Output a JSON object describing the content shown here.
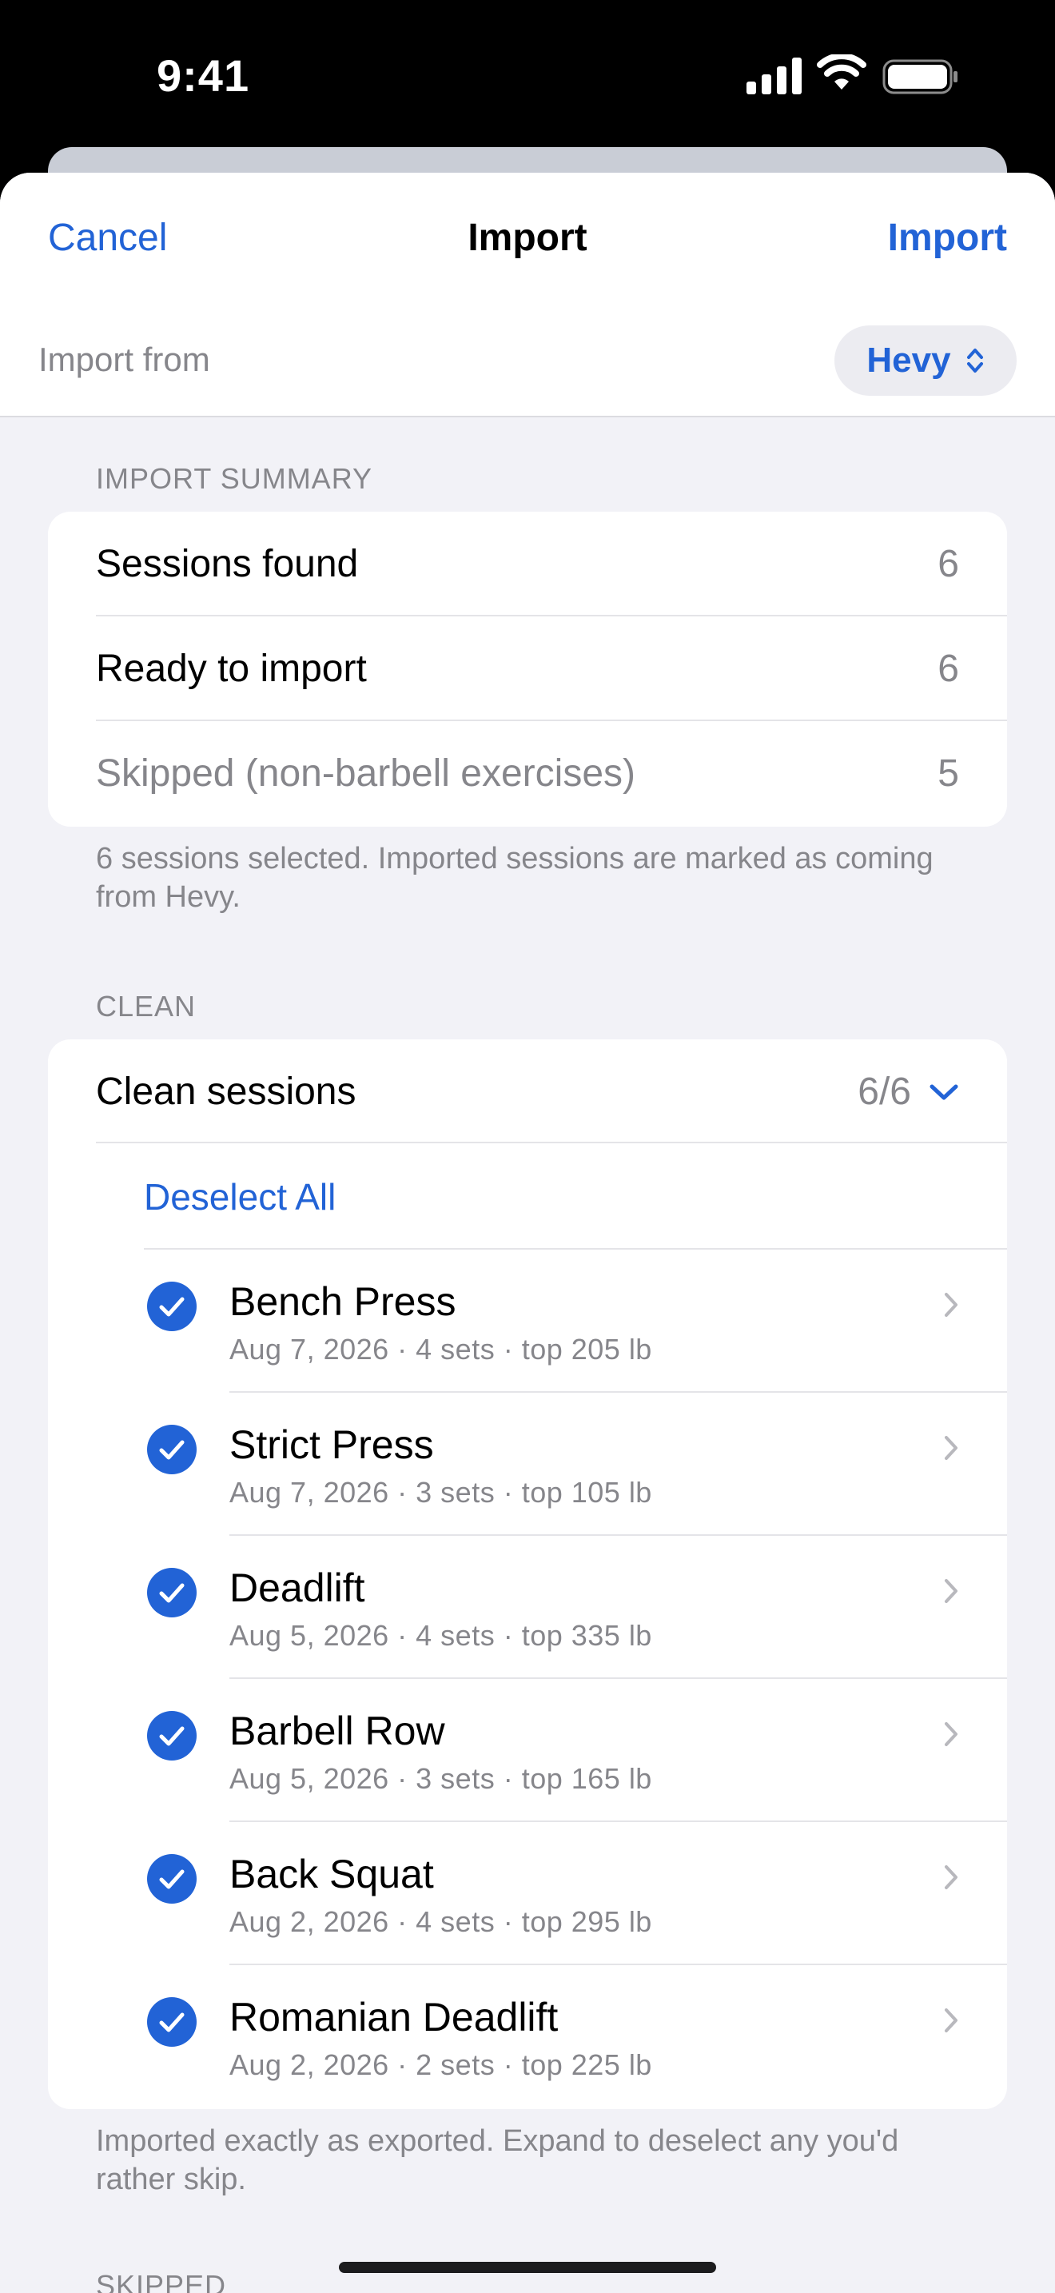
{
  "status_bar": {
    "time": "9:41"
  },
  "nav": {
    "cancel": "Cancel",
    "title": "Import",
    "import": "Import"
  },
  "source": {
    "label": "Import from",
    "value": "Hevy"
  },
  "summary": {
    "header": "IMPORT SUMMARY",
    "rows": [
      {
        "label": "Sessions found",
        "value": "6"
      },
      {
        "label": "Ready to import",
        "value": "6"
      },
      {
        "label": "Skipped (non-barbell exercises)",
        "value": "5"
      }
    ],
    "footnote": "6 sessions selected. Imported sessions are marked as coming from Hevy."
  },
  "clean": {
    "header": "CLEAN",
    "title": "Clean sessions",
    "count": "6/6",
    "deselect_all": "Deselect All",
    "sessions": [
      {
        "name": "Bench Press",
        "meta": "Aug 7, 2026 · 4 sets · top 205 lb",
        "selected": true
      },
      {
        "name": "Strict Press",
        "meta": "Aug 7, 2026 · 3 sets · top 105 lb",
        "selected": true
      },
      {
        "name": "Deadlift",
        "meta": "Aug 5, 2026 · 4 sets · top 335 lb",
        "selected": true
      },
      {
        "name": "Barbell Row",
        "meta": "Aug 5, 2026 · 3 sets · top 165 lb",
        "selected": true
      },
      {
        "name": "Back Squat",
        "meta": "Aug 2, 2026 · 4 sets · top 295 lb",
        "selected": true
      },
      {
        "name": "Romanian Deadlift",
        "meta": "Aug 2, 2026 · 2 sets · top 225 lb",
        "selected": true
      }
    ],
    "footnote": "Imported exactly as exported. Expand to deselect any you'd rather skip."
  },
  "skipped": {
    "header": "SKIPPED"
  },
  "colors": {
    "accent": "#2263d6",
    "secondary": "#86868b",
    "background": "#f2f2f7"
  }
}
